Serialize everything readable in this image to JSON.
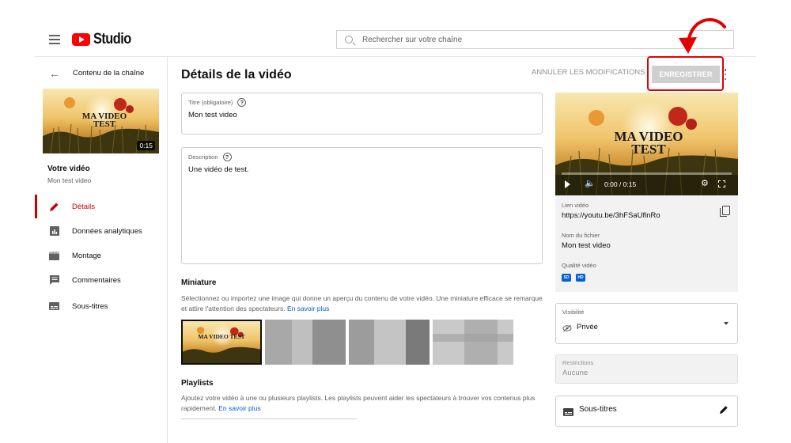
{
  "header": {
    "logo_text": "Studio",
    "search": {
      "placeholder": "Rechercher sur votre chaîne",
      "value": ""
    }
  },
  "sidebar": {
    "back_label": "Contenu de la chaîne",
    "thumbnail": {
      "overlay_text": "MA VIDEO TEST",
      "duration": "0:15"
    },
    "your_video_label": "Votre vidéo",
    "video_name": "Mon test video",
    "items": [
      {
        "label": "Détails",
        "icon": "pencil-icon",
        "active": true
      },
      {
        "label": "Données analytiques",
        "icon": "analytics-icon",
        "active": false
      },
      {
        "label": "Montage",
        "icon": "clapperboard-icon",
        "active": false
      },
      {
        "label": "Commentaires",
        "icon": "comment-icon",
        "active": false
      },
      {
        "label": "Sous-titres",
        "icon": "subtitles-icon",
        "active": false
      }
    ]
  },
  "main": {
    "page_title": "Détails de la vidéo",
    "undo_label": "ANNULER LES MODIFICATIONS",
    "save_label": "ENREGISTRER",
    "title_field": {
      "label": "Titre (obligatoire)",
      "value": "Mon test video"
    },
    "description_field": {
      "label": "Description",
      "value": "Une vidéo de test."
    },
    "thumbnail_section": {
      "heading": "Miniature",
      "text": "Sélectionnez ou importez une image qui donne un aperçu du contenu de votre vidéo. Une miniature efficace se remarque et attire l'attention des spectateurs.",
      "link": "En savoir plus"
    },
    "playlists_section": {
      "heading": "Playlists",
      "text": "Ajoutez votre vidéo à une ou plusieurs playlists. Les playlists peuvent aider les spectateurs à trouver vos contenus plus rapidement.",
      "link": "En savoir plus"
    }
  },
  "right_panel": {
    "player": {
      "overlay_text": "MA VIDEO TEST",
      "time": "0:00 / 0:15",
      "progress": 0
    },
    "video_link_label": "Lien vidéo",
    "video_link": "https://youtu.be/3hFSaUflnRo",
    "file_name_label": "Nom du fichier",
    "file_name": "Mon test video",
    "quality_label": "Qualité vidéo",
    "quality_badges": [
      "SD",
      "HD"
    ],
    "visibility_label": "Visibilité",
    "visibility_value": "Privée",
    "restrictions_label": "Restrictions",
    "restrictions_value": "Aucune",
    "subtitles_label": "Sous-titres"
  },
  "colors": {
    "accent_red": "#cc0000",
    "annotation_red": "#e40000",
    "link_blue": "#065fd4",
    "save_disabled": "#cfcfcf"
  }
}
